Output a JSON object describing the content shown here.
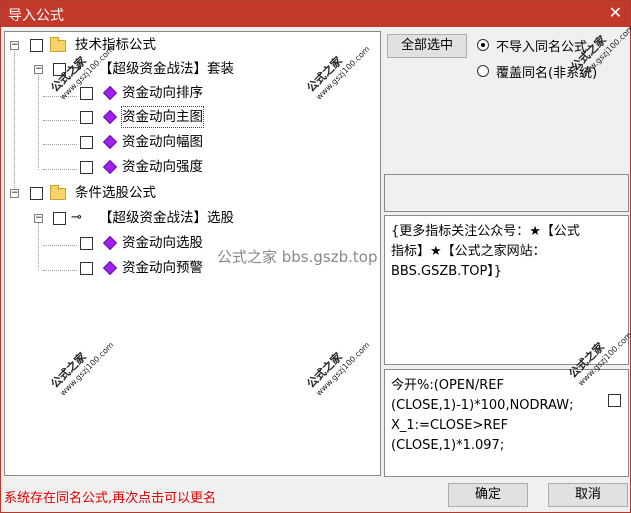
{
  "window": {
    "title": "导入公式",
    "close_glyph": "✕"
  },
  "tree": {
    "nodes": [
      {
        "label": "技术指标公式"
      },
      {
        "label": "【超级资金战法】套装"
      },
      {
        "label": "资金动向排序"
      },
      {
        "label": "资金动向主图"
      },
      {
        "label": "资金动向幅图"
      },
      {
        "label": "资金动向强度"
      },
      {
        "label": "条件选股公式"
      },
      {
        "label": "【超级资金战法】选股"
      },
      {
        "label": "资金动向选股"
      },
      {
        "label": "资金动向预警"
      }
    ]
  },
  "right": {
    "select_all_label": "全部选中",
    "radio_no_import": "不导入同名公式",
    "radio_overwrite": "覆盖同名(非系统)",
    "description": "{更多指标关注公众号：★【公式指标】★【公式之家网站：BBS.GSZB.TOP】}",
    "code": "今开%:(OPEN/REF (CLOSE,1)-1)*100,NODRAW;\nX_1:=CLOSE>REF (CLOSE,1)*1.097;"
  },
  "status_text": "系统存在同名公式,再次点击可以更名",
  "buttons": {
    "ok": "确定",
    "cancel": "取消"
  },
  "watermark": {
    "text": "公式之家",
    "url": "www.gszj100.com",
    "center": "公式之家 bbs.gszb.top"
  },
  "colors": {
    "titlebar": "#c0392b",
    "status": "#e00000",
    "gem": "#a020f0"
  }
}
